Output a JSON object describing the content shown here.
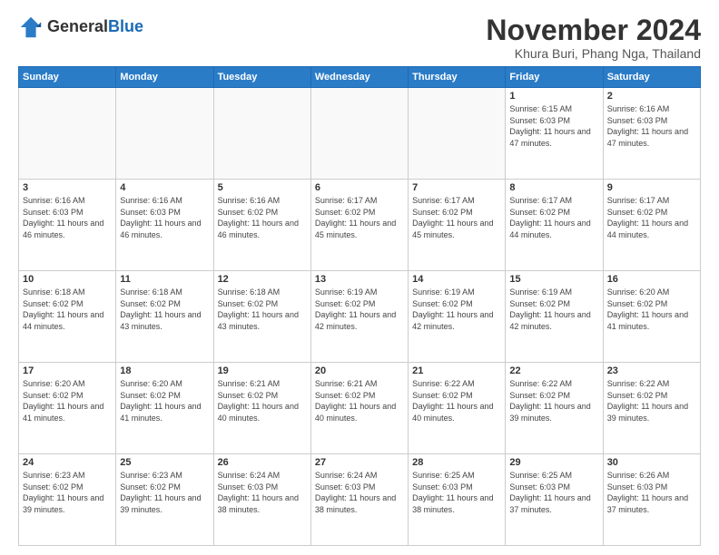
{
  "header": {
    "logo_general": "General",
    "logo_blue": "Blue",
    "month": "November 2024",
    "location": "Khura Buri, Phang Nga, Thailand"
  },
  "weekdays": [
    "Sunday",
    "Monday",
    "Tuesday",
    "Wednesday",
    "Thursday",
    "Friday",
    "Saturday"
  ],
  "weeks": [
    [
      {
        "day": "",
        "empty": true
      },
      {
        "day": "",
        "empty": true
      },
      {
        "day": "",
        "empty": true
      },
      {
        "day": "",
        "empty": true
      },
      {
        "day": "",
        "empty": true
      },
      {
        "day": "1",
        "sunrise": "6:15 AM",
        "sunset": "6:03 PM",
        "daylight": "11 hours and 47 minutes."
      },
      {
        "day": "2",
        "sunrise": "6:16 AM",
        "sunset": "6:03 PM",
        "daylight": "11 hours and 47 minutes."
      }
    ],
    [
      {
        "day": "3",
        "sunrise": "6:16 AM",
        "sunset": "6:03 PM",
        "daylight": "11 hours and 46 minutes."
      },
      {
        "day": "4",
        "sunrise": "6:16 AM",
        "sunset": "6:03 PM",
        "daylight": "11 hours and 46 minutes."
      },
      {
        "day": "5",
        "sunrise": "6:16 AM",
        "sunset": "6:02 PM",
        "daylight": "11 hours and 46 minutes."
      },
      {
        "day": "6",
        "sunrise": "6:17 AM",
        "sunset": "6:02 PM",
        "daylight": "11 hours and 45 minutes."
      },
      {
        "day": "7",
        "sunrise": "6:17 AM",
        "sunset": "6:02 PM",
        "daylight": "11 hours and 45 minutes."
      },
      {
        "day": "8",
        "sunrise": "6:17 AM",
        "sunset": "6:02 PM",
        "daylight": "11 hours and 44 minutes."
      },
      {
        "day": "9",
        "sunrise": "6:17 AM",
        "sunset": "6:02 PM",
        "daylight": "11 hours and 44 minutes."
      }
    ],
    [
      {
        "day": "10",
        "sunrise": "6:18 AM",
        "sunset": "6:02 PM",
        "daylight": "11 hours and 44 minutes."
      },
      {
        "day": "11",
        "sunrise": "6:18 AM",
        "sunset": "6:02 PM",
        "daylight": "11 hours and 43 minutes."
      },
      {
        "day": "12",
        "sunrise": "6:18 AM",
        "sunset": "6:02 PM",
        "daylight": "11 hours and 43 minutes."
      },
      {
        "day": "13",
        "sunrise": "6:19 AM",
        "sunset": "6:02 PM",
        "daylight": "11 hours and 42 minutes."
      },
      {
        "day": "14",
        "sunrise": "6:19 AM",
        "sunset": "6:02 PM",
        "daylight": "11 hours and 42 minutes."
      },
      {
        "day": "15",
        "sunrise": "6:19 AM",
        "sunset": "6:02 PM",
        "daylight": "11 hours and 42 minutes."
      },
      {
        "day": "16",
        "sunrise": "6:20 AM",
        "sunset": "6:02 PM",
        "daylight": "11 hours and 41 minutes."
      }
    ],
    [
      {
        "day": "17",
        "sunrise": "6:20 AM",
        "sunset": "6:02 PM",
        "daylight": "11 hours and 41 minutes."
      },
      {
        "day": "18",
        "sunrise": "6:20 AM",
        "sunset": "6:02 PM",
        "daylight": "11 hours and 41 minutes."
      },
      {
        "day": "19",
        "sunrise": "6:21 AM",
        "sunset": "6:02 PM",
        "daylight": "11 hours and 40 minutes."
      },
      {
        "day": "20",
        "sunrise": "6:21 AM",
        "sunset": "6:02 PM",
        "daylight": "11 hours and 40 minutes."
      },
      {
        "day": "21",
        "sunrise": "6:22 AM",
        "sunset": "6:02 PM",
        "daylight": "11 hours and 40 minutes."
      },
      {
        "day": "22",
        "sunrise": "6:22 AM",
        "sunset": "6:02 PM",
        "daylight": "11 hours and 39 minutes."
      },
      {
        "day": "23",
        "sunrise": "6:22 AM",
        "sunset": "6:02 PM",
        "daylight": "11 hours and 39 minutes."
      }
    ],
    [
      {
        "day": "24",
        "sunrise": "6:23 AM",
        "sunset": "6:02 PM",
        "daylight": "11 hours and 39 minutes."
      },
      {
        "day": "25",
        "sunrise": "6:23 AM",
        "sunset": "6:02 PM",
        "daylight": "11 hours and 39 minutes."
      },
      {
        "day": "26",
        "sunrise": "6:24 AM",
        "sunset": "6:03 PM",
        "daylight": "11 hours and 38 minutes."
      },
      {
        "day": "27",
        "sunrise": "6:24 AM",
        "sunset": "6:03 PM",
        "daylight": "11 hours and 38 minutes."
      },
      {
        "day": "28",
        "sunrise": "6:25 AM",
        "sunset": "6:03 PM",
        "daylight": "11 hours and 38 minutes."
      },
      {
        "day": "29",
        "sunrise": "6:25 AM",
        "sunset": "6:03 PM",
        "daylight": "11 hours and 37 minutes."
      },
      {
        "day": "30",
        "sunrise": "6:26 AM",
        "sunset": "6:03 PM",
        "daylight": "11 hours and 37 minutes."
      }
    ]
  ]
}
